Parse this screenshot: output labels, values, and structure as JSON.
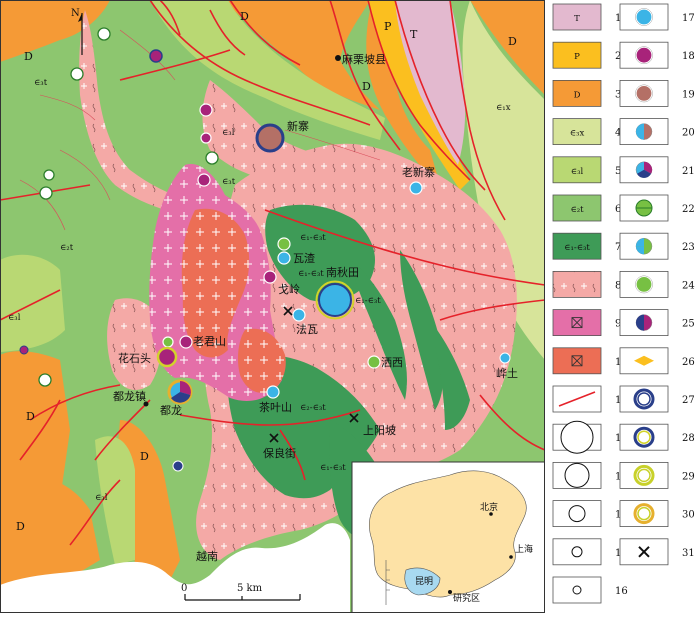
{
  "map": {
    "north": "N",
    "scale": {
      "start": "0",
      "end": "5 km"
    },
    "country_label": "越南",
    "places": {
      "malipo": "麻栗坡县",
      "xinzhai": "新寨",
      "laoxinzhai": "老新寨",
      "wazha": "瓦渣",
      "geling": "戈岭",
      "nanqiutian": "南秋田",
      "fawa": "法瓦",
      "laojunshan": "老君山",
      "huashitou": "花石头",
      "dulongzhen": "都龙镇",
      "dulong": "都龙",
      "chayeshan": "茶叶山",
      "saxi": "洒西",
      "mengtu": "㟆土",
      "shangyangpo": "上阳坡",
      "baoliangjie": "保良街"
    },
    "units": {
      "T": "T",
      "P": "P",
      "D": "D",
      "e1x": "∈₁x",
      "e3t": "∈₃t",
      "e3l": "∈₃l",
      "e2t": "∈₂t",
      "e1e3t": "∈₁-∈₃t",
      "e2e3t": "∈₂-∈₃t"
    },
    "inset": {
      "beijing": "北京",
      "shanghai": "上海",
      "kunming": "昆明",
      "study_area": "研究区"
    }
  },
  "legend": {
    "col1": [
      {
        "num": "1",
        "icon": "swatch",
        "color": "#e3b9cf",
        "text": "T"
      },
      {
        "num": "2",
        "icon": "swatch",
        "color": "#fbbf1f",
        "text": "P"
      },
      {
        "num": "3",
        "icon": "swatch",
        "color": "#f59a36",
        "text": "D"
      },
      {
        "num": "4",
        "icon": "swatch",
        "color": "#d7e49a",
        "text": "∈₃x"
      },
      {
        "num": "5",
        "icon": "swatch",
        "color": "#b9d873",
        "text": "∈₃l"
      },
      {
        "num": "6",
        "icon": "swatch",
        "color": "#8dc66f",
        "text": "∈₂t"
      },
      {
        "num": "7",
        "icon": "swatch",
        "color": "#3e9b57",
        "text": "∈₁-∈₃t"
      },
      {
        "num": "8",
        "icon": "granite",
        "color": "#f4a9a6",
        "text": ""
      },
      {
        "num": "9",
        "icon": "intrusion",
        "color": "#e46fa8",
        "text": ""
      },
      {
        "num": "10",
        "icon": "intrusion",
        "color": "#ec6e55",
        "text": ""
      },
      {
        "num": "11",
        "icon": "fault",
        "color": "#e5222a",
        "text": ""
      },
      {
        "num": "12",
        "icon": "circle",
        "size": "16",
        "text": ""
      },
      {
        "num": "13",
        "icon": "circle",
        "size": "12",
        "text": ""
      },
      {
        "num": "14",
        "icon": "circle",
        "size": "8",
        "text": ""
      },
      {
        "num": "15",
        "icon": "circle",
        "size": "5",
        "text": ""
      },
      {
        "num": "16",
        "icon": "circle",
        "size": "4",
        "text": ""
      }
    ],
    "col2": [
      {
        "num": "17",
        "icon": "fill",
        "color": "#3bb4e6"
      },
      {
        "num": "18",
        "icon": "fill",
        "color": "#a8237a"
      },
      {
        "num": "19",
        "icon": "fill",
        "color": "#b47066"
      },
      {
        "num": "20",
        "icon": "half",
        "color": "#3bb4e6",
        "color2": "#b47066"
      },
      {
        "num": "21",
        "icon": "tri",
        "color": "#3bb4e6",
        "color2": "#a8237a"
      },
      {
        "num": "22",
        "icon": "halfh",
        "color": "#77c043",
        "color2": "#77c043"
      },
      {
        "num": "23",
        "icon": "quarter",
        "color": "#3bb4e6",
        "color2": "#77c043"
      },
      {
        "num": "24",
        "icon": "fill",
        "color": "#77c043"
      },
      {
        "num": "25",
        "icon": "half",
        "color": "#2a3f8a",
        "color2": "#a8237a"
      },
      {
        "num": "26",
        "icon": "diamond",
        "color": "#fbbf1f"
      },
      {
        "num": "27",
        "icon": "ring",
        "color": "#2a3f8a",
        "color2": "#2a3f8a"
      },
      {
        "num": "28",
        "icon": "ring",
        "color": "#2a3f8a",
        "color2": "#d2d32a"
      },
      {
        "num": "29",
        "icon": "ring",
        "color": "#c8d12a",
        "color2": "#c8d12a"
      },
      {
        "num": "30",
        "icon": "ring",
        "color": "#e6b02e",
        "color2": "#c8d12a"
      },
      {
        "num": "31",
        "icon": "hammer",
        "color": "#111111"
      }
    ]
  }
}
